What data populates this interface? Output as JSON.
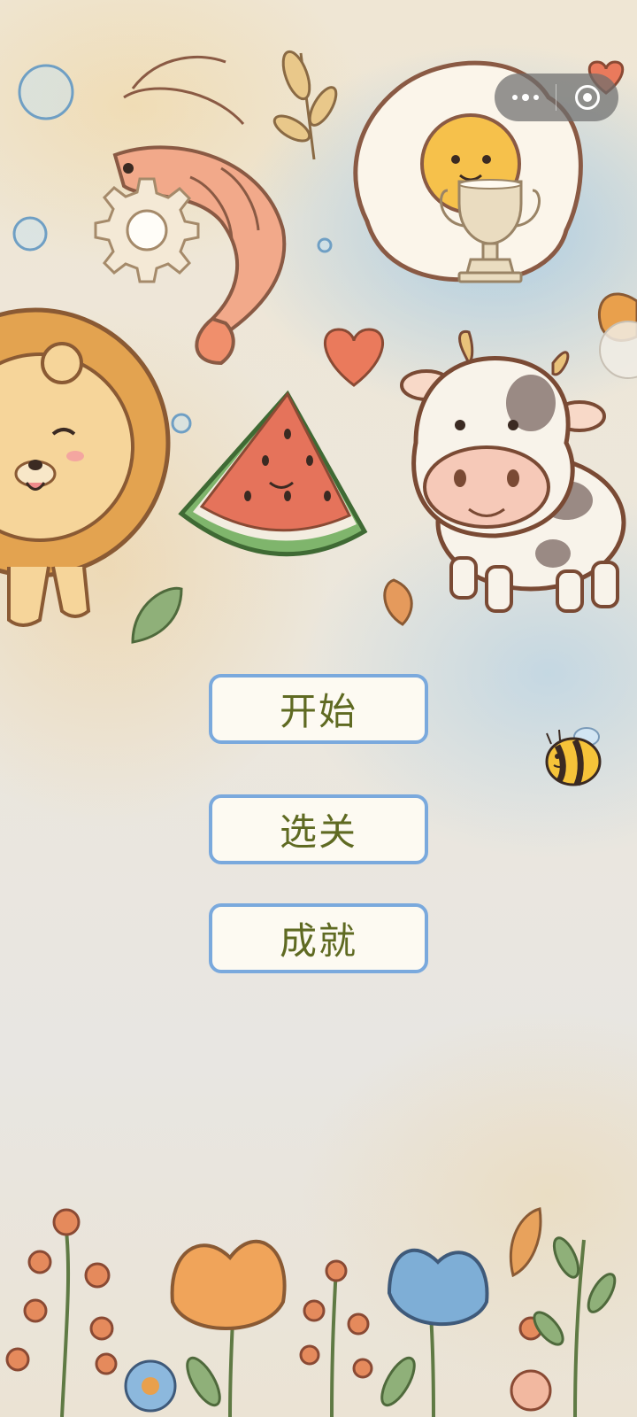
{
  "capsule": {
    "more_icon": "more-dots-icon",
    "close_icon": "close-target-icon"
  },
  "menu": {
    "start_label": "开始",
    "levels_label": "选关",
    "achievements_label": "成就"
  },
  "icons": {
    "settings": "gear-icon",
    "achievements": "trophy-icon",
    "mascot": "bee-icon"
  },
  "colors": {
    "button_border": "#7aa9dd",
    "button_fill": "#fdfaf2",
    "button_text": "#5f6a22"
  }
}
